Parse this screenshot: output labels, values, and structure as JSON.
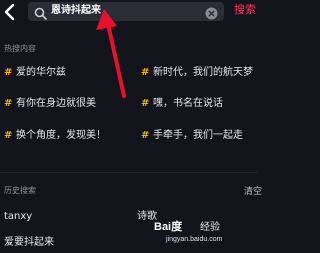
{
  "search": {
    "query": "恩诗抖起来",
    "button_label": "搜索"
  },
  "hot": {
    "section_label": "热搜内容",
    "items": [
      {
        "label": "爱的华尔兹"
      },
      {
        "label": "新时代，我们的航天梦"
      },
      {
        "label": "有你在身边就很美"
      },
      {
        "label": "嘿，书名在说话"
      },
      {
        "label": "换个角度，发现美！"
      },
      {
        "label": "手牵手，我们一起走"
      }
    ],
    "marker": "#",
    "marker_color": "#f6b10a"
  },
  "history": {
    "section_label": "历史搜索",
    "clear_label": "清空",
    "items": [
      {
        "label": "tanxy"
      },
      {
        "label": "诗歌"
      },
      {
        "label": "爱要抖起来"
      }
    ]
  },
  "watermark": {
    "brand": "Bai度",
    "product": "经验",
    "url": "jingyan.baidu.com"
  },
  "colors": {
    "background": "#14141c",
    "search_bg": "#2c2c36",
    "accent": "#f63b5c",
    "annotation": "#e8102a"
  }
}
